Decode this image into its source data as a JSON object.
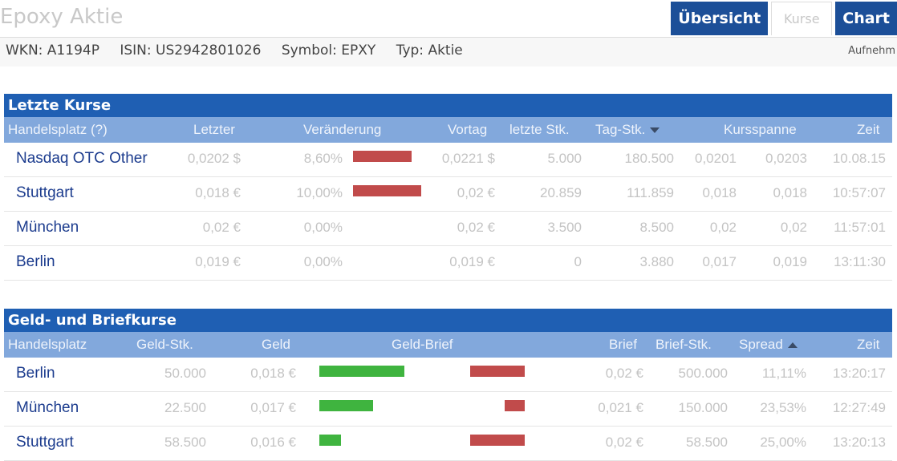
{
  "header": {
    "title": "Epoxy Aktie"
  },
  "tabs": [
    {
      "label": "Übersicht"
    },
    {
      "label": "Kurse"
    },
    {
      "label": "Chart"
    }
  ],
  "ids": {
    "wkn": "WKN: A1194P",
    "isin": "ISIN: US2942801026",
    "symbol": "Symbol: EPXY",
    "typ": "Typ: Aktie",
    "add": "Aufnehm"
  },
  "kurse": {
    "title": "Letzte Kurse",
    "headers": [
      "Handelsplatz (?)",
      "Letzter",
      "Veränderung",
      "Vortag",
      "letzte Stk.",
      "Tag-Stk.",
      "Kursspanne",
      "Zeit"
    ],
    "rows": [
      {
        "place": "Nasdaq OTC Other",
        "last": "0,0202 $",
        "change": "8,60%",
        "change_pct": 8.6,
        "prev": "0,0221 $",
        "last_stk": "5.000",
        "day_stk": "180.500",
        "range_low": "0,0201",
        "range_high": "0,0203",
        "time": "10.08.15"
      },
      {
        "place": "Stuttgart",
        "last": "0,018 €",
        "change": "10,00%",
        "change_pct": 10.0,
        "prev": "0,02 €",
        "last_stk": "20.859",
        "day_stk": "111.859",
        "range_low": "0,018",
        "range_high": "0,018",
        "time": "10:57:07"
      },
      {
        "place": "München",
        "last": "0,02 €",
        "change": "0,00%",
        "change_pct": 0,
        "prev": "0,02 €",
        "last_stk": "3.500",
        "day_stk": "8.500",
        "range_low": "0,02",
        "range_high": "0,02",
        "time": "11:57:01"
      },
      {
        "place": "Berlin",
        "last": "0,019 €",
        "change": "0,00%",
        "change_pct": 0,
        "prev": "0,019 €",
        "last_stk": "0",
        "day_stk": "3.880",
        "range_low": "0,017",
        "range_high": "0,019",
        "time": "13:11:30"
      }
    ]
  },
  "geldbrief": {
    "title": "Geld- und Briefkurse",
    "headers": [
      "Handelsplatz",
      "Geld-Stk.",
      "Geld",
      "Geld-Brief",
      "Brief",
      "Brief-Stk.",
      "Spread",
      "Zeit"
    ],
    "rows": [
      {
        "place": "Berlin",
        "geld_stk": "50.000",
        "geld": "0,018 €",
        "brief": "0,02 €",
        "brief_stk": "500.000",
        "spread": "11,11%",
        "time": "13:20:17",
        "geld_bar": 0.59,
        "brief_bar": 0.38
      },
      {
        "place": "München",
        "geld_stk": "22.500",
        "geld": "0,017 €",
        "brief": "0,021 €",
        "brief_stk": "150.000",
        "spread": "23,53%",
        "time": "12:27:49",
        "geld_bar": 0.37,
        "brief_bar": 0.14
      },
      {
        "place": "Stuttgart",
        "geld_stk": "58.500",
        "geld": "0,016 €",
        "brief": "0,02 €",
        "brief_stk": "58.500",
        "spread": "25,00%",
        "time": "13:20:13",
        "geld_bar": 0.15,
        "brief_bar": 0.38
      }
    ]
  },
  "colors": {
    "header_blue": "#1f5fb3",
    "subheader_blue": "#82a8dc",
    "bar_red": "#c14b4b",
    "bar_green": "#3fb43f",
    "link": "#1c3c8e"
  }
}
